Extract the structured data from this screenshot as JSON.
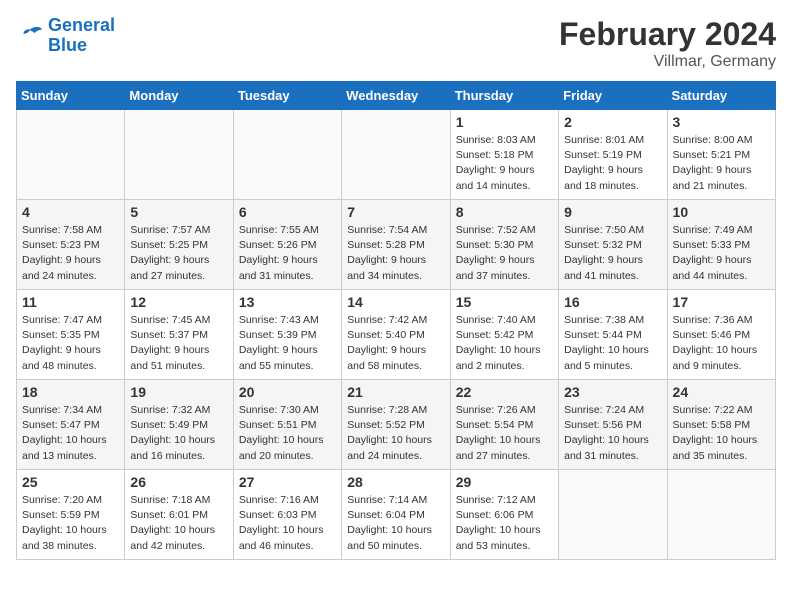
{
  "header": {
    "logo_line1": "General",
    "logo_line2": "Blue",
    "month": "February 2024",
    "location": "Villmar, Germany"
  },
  "weekdays": [
    "Sunday",
    "Monday",
    "Tuesday",
    "Wednesday",
    "Thursday",
    "Friday",
    "Saturday"
  ],
  "weeks": [
    [
      {
        "day": "",
        "info": ""
      },
      {
        "day": "",
        "info": ""
      },
      {
        "day": "",
        "info": ""
      },
      {
        "day": "",
        "info": ""
      },
      {
        "day": "1",
        "info": "Sunrise: 8:03 AM\nSunset: 5:18 PM\nDaylight: 9 hours\nand 14 minutes."
      },
      {
        "day": "2",
        "info": "Sunrise: 8:01 AM\nSunset: 5:19 PM\nDaylight: 9 hours\nand 18 minutes."
      },
      {
        "day": "3",
        "info": "Sunrise: 8:00 AM\nSunset: 5:21 PM\nDaylight: 9 hours\nand 21 minutes."
      }
    ],
    [
      {
        "day": "4",
        "info": "Sunrise: 7:58 AM\nSunset: 5:23 PM\nDaylight: 9 hours\nand 24 minutes."
      },
      {
        "day": "5",
        "info": "Sunrise: 7:57 AM\nSunset: 5:25 PM\nDaylight: 9 hours\nand 27 minutes."
      },
      {
        "day": "6",
        "info": "Sunrise: 7:55 AM\nSunset: 5:26 PM\nDaylight: 9 hours\nand 31 minutes."
      },
      {
        "day": "7",
        "info": "Sunrise: 7:54 AM\nSunset: 5:28 PM\nDaylight: 9 hours\nand 34 minutes."
      },
      {
        "day": "8",
        "info": "Sunrise: 7:52 AM\nSunset: 5:30 PM\nDaylight: 9 hours\nand 37 minutes."
      },
      {
        "day": "9",
        "info": "Sunrise: 7:50 AM\nSunset: 5:32 PM\nDaylight: 9 hours\nand 41 minutes."
      },
      {
        "day": "10",
        "info": "Sunrise: 7:49 AM\nSunset: 5:33 PM\nDaylight: 9 hours\nand 44 minutes."
      }
    ],
    [
      {
        "day": "11",
        "info": "Sunrise: 7:47 AM\nSunset: 5:35 PM\nDaylight: 9 hours\nand 48 minutes."
      },
      {
        "day": "12",
        "info": "Sunrise: 7:45 AM\nSunset: 5:37 PM\nDaylight: 9 hours\nand 51 minutes."
      },
      {
        "day": "13",
        "info": "Sunrise: 7:43 AM\nSunset: 5:39 PM\nDaylight: 9 hours\nand 55 minutes."
      },
      {
        "day": "14",
        "info": "Sunrise: 7:42 AM\nSunset: 5:40 PM\nDaylight: 9 hours\nand 58 minutes."
      },
      {
        "day": "15",
        "info": "Sunrise: 7:40 AM\nSunset: 5:42 PM\nDaylight: 10 hours\nand 2 minutes."
      },
      {
        "day": "16",
        "info": "Sunrise: 7:38 AM\nSunset: 5:44 PM\nDaylight: 10 hours\nand 5 minutes."
      },
      {
        "day": "17",
        "info": "Sunrise: 7:36 AM\nSunset: 5:46 PM\nDaylight: 10 hours\nand 9 minutes."
      }
    ],
    [
      {
        "day": "18",
        "info": "Sunrise: 7:34 AM\nSunset: 5:47 PM\nDaylight: 10 hours\nand 13 minutes."
      },
      {
        "day": "19",
        "info": "Sunrise: 7:32 AM\nSunset: 5:49 PM\nDaylight: 10 hours\nand 16 minutes."
      },
      {
        "day": "20",
        "info": "Sunrise: 7:30 AM\nSunset: 5:51 PM\nDaylight: 10 hours\nand 20 minutes."
      },
      {
        "day": "21",
        "info": "Sunrise: 7:28 AM\nSunset: 5:52 PM\nDaylight: 10 hours\nand 24 minutes."
      },
      {
        "day": "22",
        "info": "Sunrise: 7:26 AM\nSunset: 5:54 PM\nDaylight: 10 hours\nand 27 minutes."
      },
      {
        "day": "23",
        "info": "Sunrise: 7:24 AM\nSunset: 5:56 PM\nDaylight: 10 hours\nand 31 minutes."
      },
      {
        "day": "24",
        "info": "Sunrise: 7:22 AM\nSunset: 5:58 PM\nDaylight: 10 hours\nand 35 minutes."
      }
    ],
    [
      {
        "day": "25",
        "info": "Sunrise: 7:20 AM\nSunset: 5:59 PM\nDaylight: 10 hours\nand 38 minutes."
      },
      {
        "day": "26",
        "info": "Sunrise: 7:18 AM\nSunset: 6:01 PM\nDaylight: 10 hours\nand 42 minutes."
      },
      {
        "day": "27",
        "info": "Sunrise: 7:16 AM\nSunset: 6:03 PM\nDaylight: 10 hours\nand 46 minutes."
      },
      {
        "day": "28",
        "info": "Sunrise: 7:14 AM\nSunset: 6:04 PM\nDaylight: 10 hours\nand 50 minutes."
      },
      {
        "day": "29",
        "info": "Sunrise: 7:12 AM\nSunset: 6:06 PM\nDaylight: 10 hours\nand 53 minutes."
      },
      {
        "day": "",
        "info": ""
      },
      {
        "day": "",
        "info": ""
      }
    ]
  ]
}
